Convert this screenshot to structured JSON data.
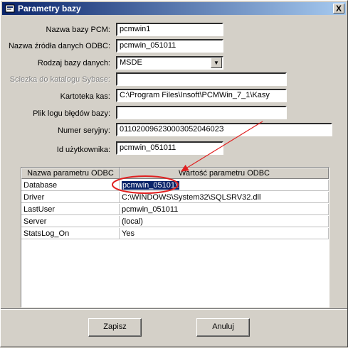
{
  "window": {
    "title": "Parametry bazy",
    "close": "X"
  },
  "form": {
    "nazwa_bazy_label": "Nazwa bazy PCM:",
    "nazwa_bazy_value": "pcmwin1",
    "nazwa_zrodla_label": "Nazwa źródła danych ODBC:",
    "nazwa_zrodla_value": "pcmwin_051011",
    "rodzaj_bazy_label": "Rodzaj bazy danych:",
    "rodzaj_bazy_value": "MSDE",
    "sciezka_label": "Sciezka do katalogu Sybase:",
    "sciezka_value": "",
    "kartoteka_label": "Kartoteka kas:",
    "kartoteka_value": "C:\\Program Files\\Insoft\\PCMWin_7_1\\Kasy",
    "plik_logu_label": "Plik logu błędów bazy:",
    "plik_logu_value": "",
    "numer_label": "Numer seryjny:",
    "numer_value": "01102009623000305204602З",
    "id_label": "Id użytkownika:",
    "id_value": "pcmwin_051011"
  },
  "grid": {
    "col1": "Nazwa parametru ODBC",
    "col2": "Wartość parametru ODBC",
    "rows": [
      {
        "name": "Database",
        "value": "pcmwin_051011"
      },
      {
        "name": "Driver",
        "value": "C:\\WINDOWS\\System32\\SQLSRV32.dll"
      },
      {
        "name": "LastUser",
        "value": "pcmwin_051011"
      },
      {
        "name": "Server",
        "value": "(local)"
      },
      {
        "name": "StatsLog_On",
        "value": "Yes"
      }
    ]
  },
  "buttons": {
    "save": "Zapisz",
    "cancel": "Anuluj"
  },
  "colors": {
    "annotation": "#e02020",
    "selection": "#0a246a"
  }
}
